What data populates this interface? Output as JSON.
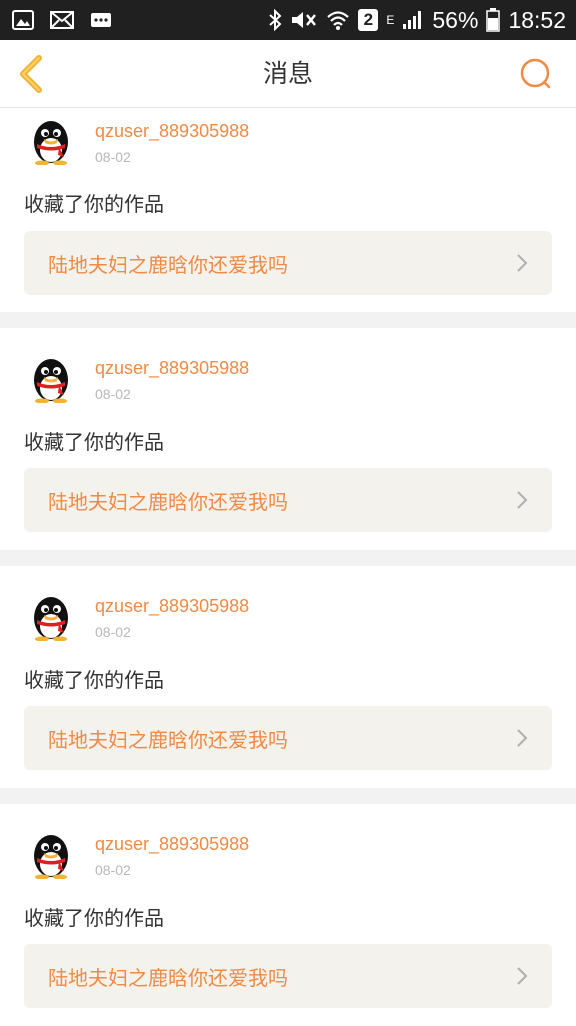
{
  "statusbar": {
    "sim_badge": "2",
    "network_type": "E",
    "battery": "56%",
    "time": "18:52"
  },
  "header": {
    "title": "消息"
  },
  "messages": [
    {
      "username": "qzuser_889305988",
      "date": "08-02",
      "action": "收藏了你的作品",
      "work_title": "陆地夫妇之鹿晗你还爱我吗"
    },
    {
      "username": "qzuser_889305988",
      "date": "08-02",
      "action": "收藏了你的作品",
      "work_title": "陆地夫妇之鹿晗你还爱我吗"
    },
    {
      "username": "qzuser_889305988",
      "date": "08-02",
      "action": "收藏了你的作品",
      "work_title": "陆地夫妇之鹿晗你还爱我吗"
    },
    {
      "username": "qzuser_889305988",
      "date": "08-02",
      "action": "收藏了你的作品",
      "work_title": "陆地夫妇之鹿晗你还爱我吗"
    }
  ],
  "colors": {
    "accent": "#f08a44",
    "back_arrow": "#f2b233",
    "card_bg": "#f3f2ec"
  }
}
